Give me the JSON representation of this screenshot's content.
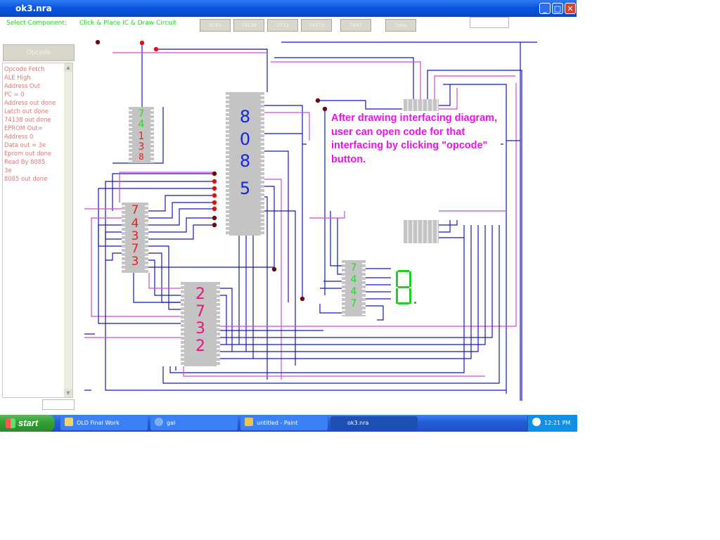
{
  "window": {
    "title": "ok3.nra",
    "controls": {
      "minimize": "_",
      "maximize": "□",
      "close": "✕"
    }
  },
  "toolbar": {
    "select_component_label": "Select Component:",
    "instruction_label": "Click & Place IC & Draw Circuit",
    "buttons": [
      "8085",
      "74138",
      "2732",
      "74373",
      "7447",
      "7seg"
    ],
    "field_value": ""
  },
  "sidebar": {
    "opcode_button_label": "Opcode",
    "log_lines": [
      "Opcode Fetch",
      "ALE High",
      "Address Out",
      "PC = 0",
      "Address out done",
      "Latch out done",
      "74138 out done",
      "EPROM Out=",
      "Address 0",
      "Data out = 3e",
      "Eprom out done",
      "Read By 8085",
      "3e",
      "8085 out done"
    ],
    "bottom_field_value": ""
  },
  "chips": {
    "decoder": [
      "7",
      "4",
      "1",
      "3",
      "8"
    ],
    "latch": [
      "7",
      "4",
      "3",
      "7",
      "3"
    ],
    "cpu": [
      "8",
      "0",
      "8",
      "5"
    ],
    "eprom": [
      "2",
      "7",
      "3",
      "2"
    ],
    "bcd_driver": [
      "7",
      "4",
      "4",
      "7"
    ]
  },
  "annotation": {
    "text": "After drawing interfacing diagram, user can open code for that interfacing by clicking \"opcode\" button."
  },
  "colors": {
    "wire_blue": "#1414c8",
    "wire_magenta": "#d24ad2",
    "node_red": "#e01010",
    "node_dark": "#6a0a0a",
    "chip_gray": "#c4c4c4",
    "decoder_text": "#2bd62b",
    "latch_text": "#e82020",
    "cpu_text": "#1028e0",
    "eprom_text": "#e01a80",
    "seven_segment": "#1ed01e",
    "annotation_text": "#ee10ee"
  },
  "taskbar": {
    "start_label": "start",
    "tasks": [
      {
        "label": "OLD Final Work",
        "icon": "folder-icon"
      },
      {
        "label": "gal",
        "icon": "globe-icon"
      },
      {
        "label": "untitled - Paint",
        "icon": "paint-icon"
      },
      {
        "label": "ok3.nra",
        "icon": "app-icon"
      }
    ],
    "clock": "12:21 PM"
  }
}
